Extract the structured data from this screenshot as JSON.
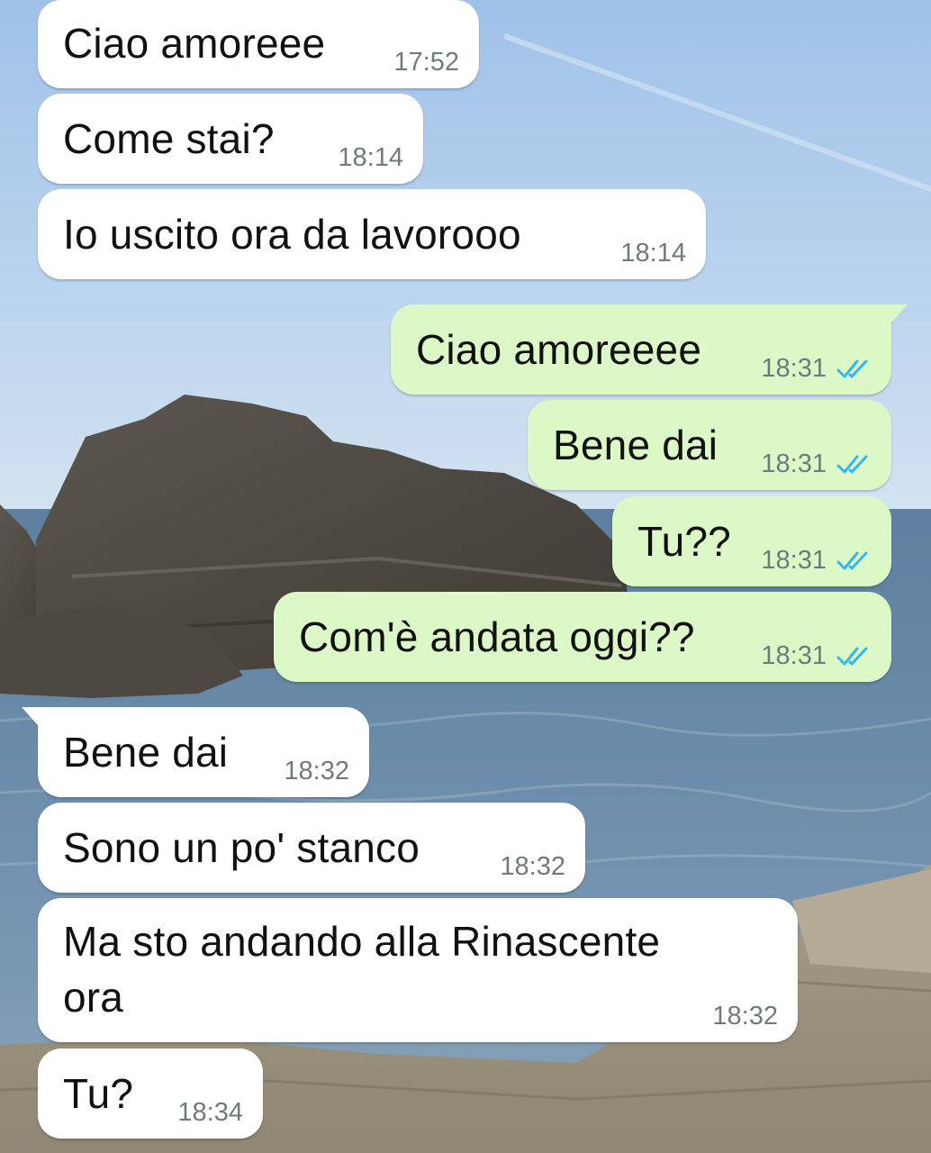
{
  "conversation": {
    "messages": [
      {
        "direction": "in",
        "text": "Ciao amoreee",
        "time": "17:52"
      },
      {
        "direction": "in",
        "text": "Come stai?",
        "time": "18:14"
      },
      {
        "direction": "in",
        "text": "Io uscito ora da lavorooo",
        "time": "18:14"
      },
      {
        "direction": "out",
        "text": "Ciao amoreeee",
        "time": "18:31",
        "status": "double-check-read-icon"
      },
      {
        "direction": "out",
        "text": "Bene dai",
        "time": "18:31",
        "status": "double-check-read-icon"
      },
      {
        "direction": "out",
        "text": "Tu??",
        "time": "18:31",
        "status": "double-check-read-icon"
      },
      {
        "direction": "out",
        "text": "Com'è andata oggi??",
        "time": "18:31",
        "status": "double-check-read-icon"
      },
      {
        "direction": "in",
        "text": "Bene dai",
        "time": "18:32"
      },
      {
        "direction": "in",
        "text": "Sono un po' stanco",
        "time": "18:32"
      },
      {
        "direction": "in",
        "text": "Ma sto andando alla Rinascente",
        "text_line2": "ora",
        "time": "18:32"
      },
      {
        "direction": "in",
        "text": "Tu?",
        "time": "18:34"
      }
    ]
  },
  "colors": {
    "incoming_bubble": "#ffffff",
    "outgoing_bubble": "#dcf8c6",
    "read_ticks": "#34b7f1",
    "timestamp": "#6f7a7d"
  }
}
